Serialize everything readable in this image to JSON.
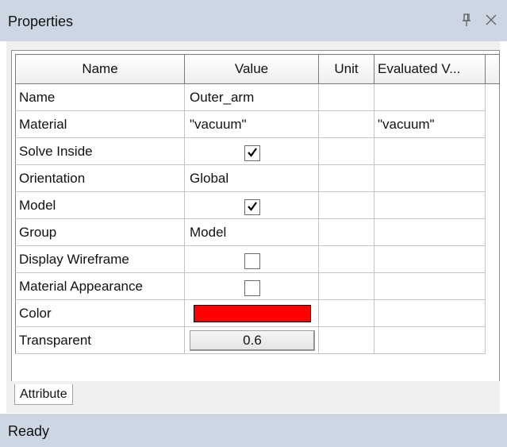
{
  "window": {
    "title": "Properties",
    "pin_icon": "pin-icon",
    "close_icon": "close-icon"
  },
  "grid": {
    "columns": [
      "Name",
      "Value",
      "Unit",
      "Evaluated V..."
    ],
    "rows": [
      {
        "name": "Name",
        "type": "text",
        "value": "Outer_arm",
        "unit": "",
        "evaluated": ""
      },
      {
        "name": "Material",
        "type": "text",
        "value": "\"vacuum\"",
        "unit": "",
        "evaluated": "\"vacuum\""
      },
      {
        "name": "Solve Inside",
        "type": "checkbox",
        "checked": true,
        "unit": "",
        "evaluated": ""
      },
      {
        "name": "Orientation",
        "type": "text",
        "value": "Global",
        "unit": "",
        "evaluated": ""
      },
      {
        "name": "Model",
        "type": "checkbox",
        "checked": true,
        "unit": "",
        "evaluated": ""
      },
      {
        "name": "Group",
        "type": "text",
        "value": "Model",
        "unit": "",
        "evaluated": ""
      },
      {
        "name": "Display Wireframe",
        "type": "checkbox",
        "checked": false,
        "unit": "",
        "evaluated": ""
      },
      {
        "name": "Material Appearance",
        "type": "checkbox",
        "checked": false,
        "unit": "",
        "evaluated": ""
      },
      {
        "name": "Color",
        "type": "color",
        "color": "#ff0000",
        "unit": "",
        "evaluated": ""
      },
      {
        "name": "Transparent",
        "type": "button",
        "value": "0.6",
        "unit": "",
        "evaluated": ""
      }
    ]
  },
  "tabs": [
    "Attribute"
  ],
  "status": {
    "text": "Ready"
  },
  "colors": {
    "titlebar_bg": "#cdd6e3",
    "statusbar_bg": "#cdd6e3",
    "color_swatch": "#ff0000"
  }
}
